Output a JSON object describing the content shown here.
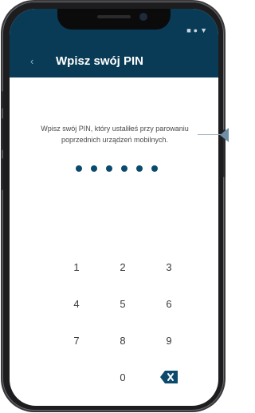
{
  "app": {
    "title": "Wpisz swój PIN",
    "back_icon": "chevron-left-icon"
  },
  "status_bar": {
    "icons": [
      "square-icon",
      "circle-icon",
      "triangle-icon"
    ]
  },
  "content": {
    "description": "Wpisz swój PIN, który ustaliłeś przy parowaniu poprzednich urządzeń mobilnych.",
    "pin_dots_filled": 6
  },
  "keypad": {
    "keys": [
      "1",
      "2",
      "3",
      "4",
      "5",
      "6",
      "7",
      "8",
      "9",
      "0"
    ],
    "delete_icon": "backspace-icon"
  },
  "colors": {
    "header": "#0a3b56",
    "accent": "#0b4a6c",
    "text": "#4a4a4a"
  }
}
